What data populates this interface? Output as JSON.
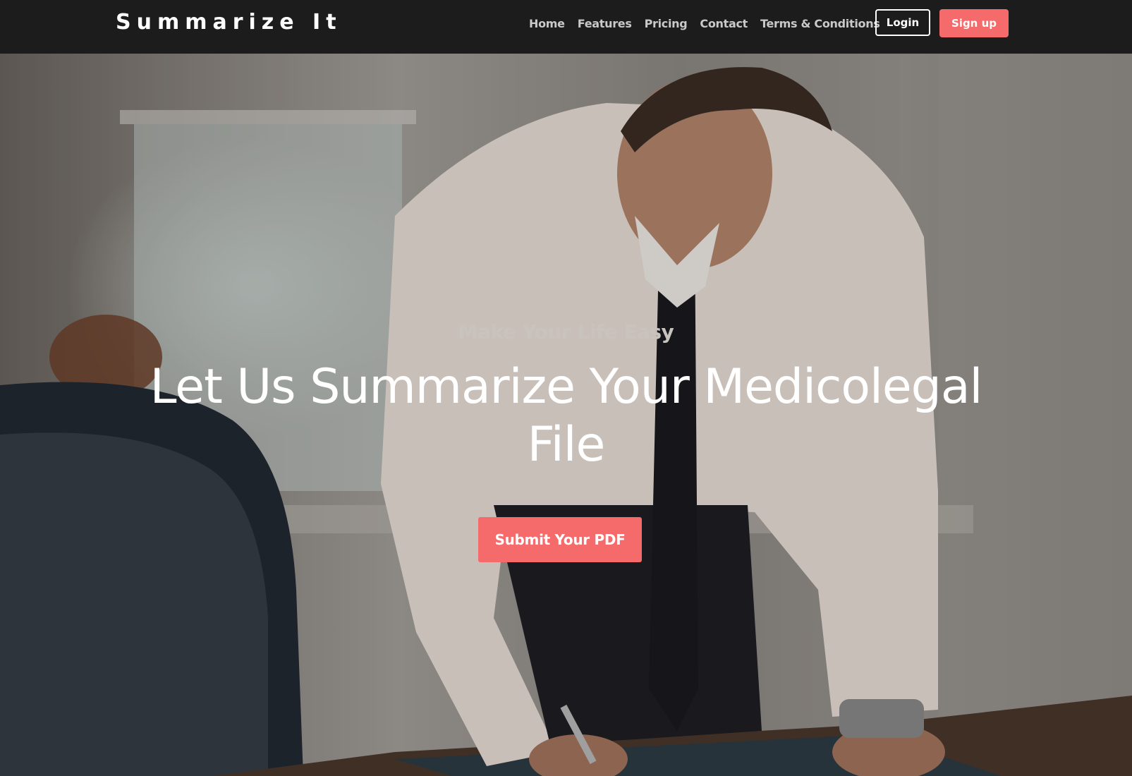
{
  "brand": {
    "name": "Summarize It"
  },
  "nav": {
    "links": [
      "Home",
      "Features",
      "Pricing",
      "Contact",
      "Terms & Conditions"
    ],
    "login_label": "Login",
    "signup_label": "Sign up"
  },
  "hero": {
    "tagline": "Make Your Life Easy",
    "headline": "Let Us Summarize Your Medicolegal File",
    "cta_label": "Submit Your PDF",
    "image_name": "businessman-writing-at-desk-photo"
  },
  "colors": {
    "navbar_bg": "#1c1c1c",
    "accent": "#f56a6a",
    "text_light": "#ffffff"
  }
}
